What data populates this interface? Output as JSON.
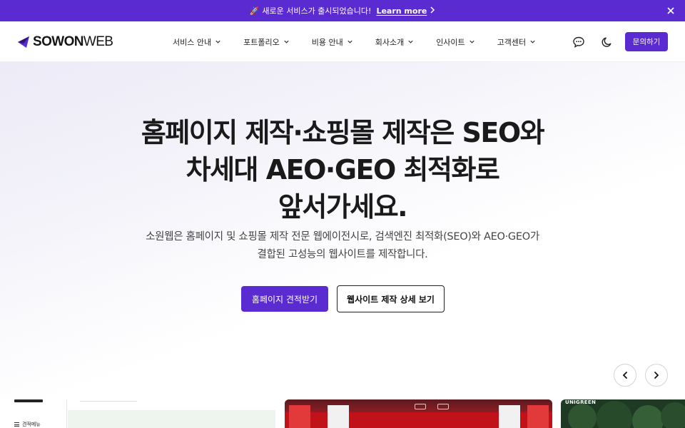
{
  "announcement": {
    "rocket": "🚀",
    "text": "새로운 서비스가 출시되었습니다!",
    "link": "Learn more"
  },
  "header": {
    "logo": {
      "bold": "SOWON",
      "thin": "WEB"
    },
    "nav": [
      {
        "label": "서비스 안내"
      },
      {
        "label": "포트폴리오"
      },
      {
        "label": "비용 안내"
      },
      {
        "label": "회사소개"
      },
      {
        "label": "인사이트"
      },
      {
        "label": "고객센터"
      }
    ],
    "cta": "문의하기"
  },
  "hero": {
    "headline": [
      "홈페이지 제작·쇼핑몰 제작은 SEO와",
      "차세대 AEO·GEO 최적화로",
      "앞서가세요."
    ],
    "subtitle": [
      "소원웹은 홈페이지 및 쇼핑몰 제작 전문 웹에이전시로, 검색엔진 최적화(SEO)와 AEO·GEO가",
      "결합된 고성능의 웹사이트를 제작합니다."
    ],
    "primary_button": "홈페이지 견적받기",
    "secondary_button": "웹사이트 제작 상세 보기"
  },
  "carousel": {
    "card1_menu_item": "견적메뉴",
    "card3_label": "UNIGREEN"
  },
  "colors": {
    "brand": "#5a2bd1",
    "text": "#1a1a1a"
  },
  "icons": {
    "close": "close-icon",
    "chat": "chat-bubble-icon",
    "theme": "moon-icon",
    "prev": "chevron-left-icon",
    "next": "chevron-right-icon"
  }
}
